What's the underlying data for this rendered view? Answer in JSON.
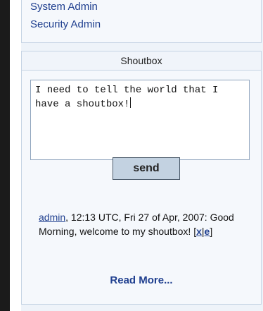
{
  "admin_links": [
    "System Admin",
    "Security Admin"
  ],
  "shoutbox": {
    "title": "Shoutbox",
    "input_value": "I need to tell the world that I have a shoutbox!",
    "send_label": "send",
    "messages": [
      {
        "author": "admin",
        "meta": ", 12:13 UTC, Fri 27 of Apr, 2007: ",
        "text": "Good Morning, welcome to my shoutbox! ",
        "bracket_open": "[",
        "edit_x": "x",
        "sep": "|",
        "edit_e": "e",
        "bracket_close": "]"
      }
    ],
    "read_more": "Read More..."
  },
  "colors": {
    "link": "#1f3f8f",
    "panel_bg": "#eef3f9",
    "border": "#c6d4e4",
    "button_bg": "#c3d2e1"
  }
}
